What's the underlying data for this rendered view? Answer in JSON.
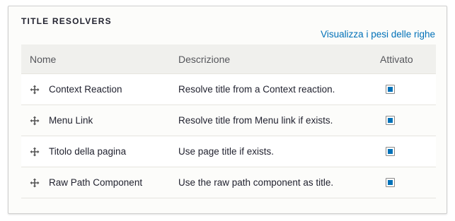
{
  "fieldset": {
    "legend": "Title resolvers",
    "weights_link": "Visualizza i pesi delle righe"
  },
  "table": {
    "headers": {
      "name": "Nome",
      "description": "Descrizione",
      "enabled": "Attivato"
    },
    "rows": [
      {
        "name": "Context Reaction",
        "description": "Resolve title from a Context reaction.",
        "enabled": true
      },
      {
        "name": "Menu Link",
        "description": "Resolve title from Menu link if exists.",
        "enabled": true
      },
      {
        "name": "Titolo della pagina",
        "description": "Use page title if exists.",
        "enabled": true
      },
      {
        "name": "Raw Path Component",
        "description": "Use the raw path component as title.",
        "enabled": true
      }
    ]
  },
  "colors": {
    "link": "#0071b8",
    "checkbox_fill": "#0071b8"
  },
  "icons": {
    "drag_handle": "drag-handle-icon"
  }
}
